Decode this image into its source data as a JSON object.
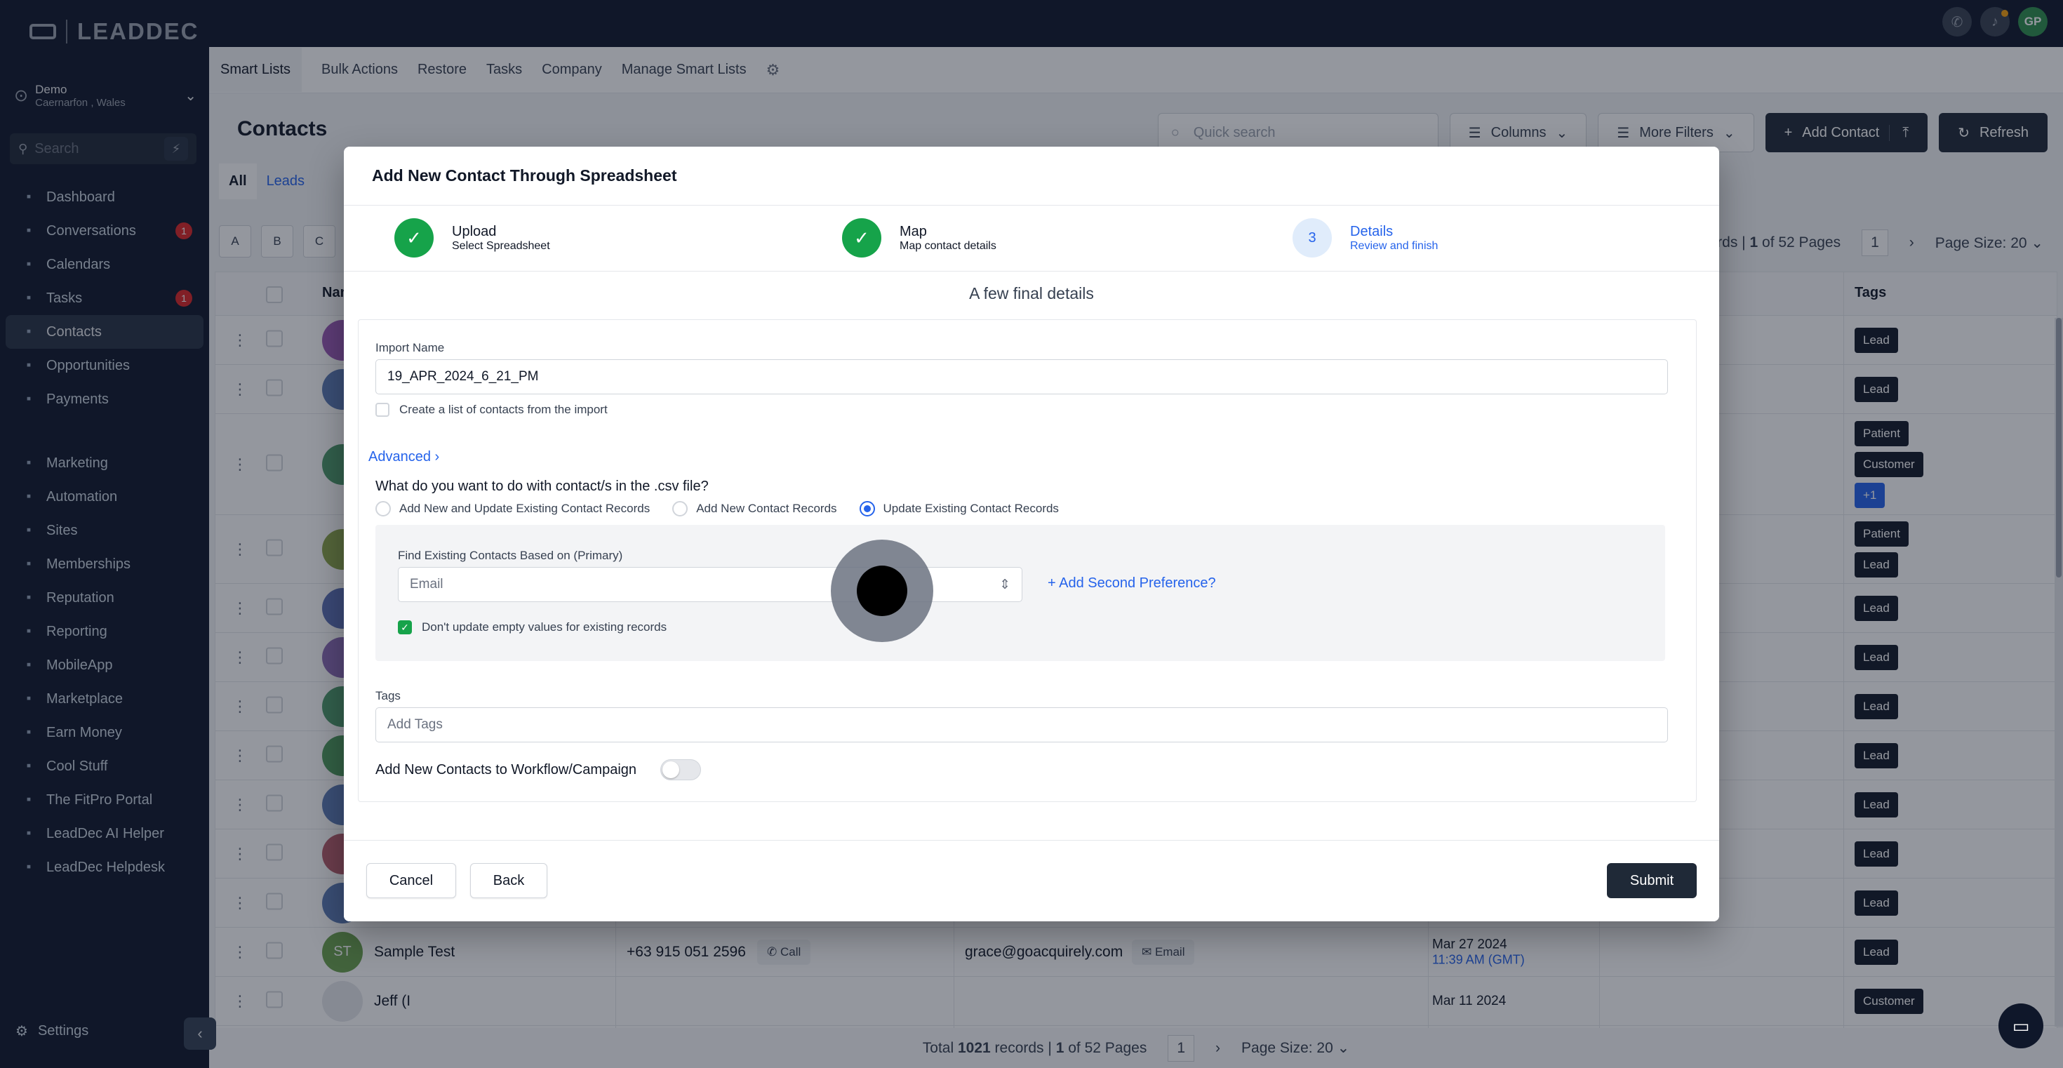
{
  "sidebar": {
    "brand": "LEADDEC",
    "location": {
      "name": "Demo",
      "address": "Caernarfon , Wales"
    },
    "search_placeholder": "Search",
    "items": [
      {
        "label": "Dashboard",
        "icon": "dashboard-icon",
        "badge": ""
      },
      {
        "label": "Conversations",
        "icon": "chat-icon",
        "badge": "1"
      },
      {
        "label": "Calendars",
        "icon": "calendar-icon",
        "badge": ""
      },
      {
        "label": "Tasks",
        "icon": "check-icon",
        "badge": "1"
      },
      {
        "label": "Contacts",
        "icon": "user-icon",
        "badge": ""
      },
      {
        "label": "Opportunities",
        "icon": "funnel-icon",
        "badge": ""
      },
      {
        "label": "Payments",
        "icon": "card-icon",
        "badge": ""
      }
    ],
    "items2": [
      {
        "label": "Marketing",
        "icon": "megaphone-icon"
      },
      {
        "label": "Automation",
        "icon": "automation-icon"
      },
      {
        "label": "Sites",
        "icon": "globe-icon"
      },
      {
        "label": "Memberships",
        "icon": "members-icon"
      },
      {
        "label": "Reputation",
        "icon": "star-icon"
      },
      {
        "label": "Reporting",
        "icon": "chart-icon"
      },
      {
        "label": "MobileApp",
        "icon": "phone-icon"
      },
      {
        "label": "Marketplace",
        "icon": "cart-icon"
      },
      {
        "label": "Earn Money",
        "icon": "money-icon"
      },
      {
        "label": "Cool Stuff",
        "icon": "fire-icon"
      },
      {
        "label": "The FitPro Portal",
        "icon": "dumbbell-icon"
      },
      {
        "label": "LeadDec AI Helper",
        "icon": "robot-icon"
      },
      {
        "label": "LeadDec Helpdesk",
        "icon": "info-icon"
      }
    ],
    "settings": "Settings",
    "user_initials": "GP"
  },
  "subnav": {
    "items": [
      "Smart Lists",
      "Bulk Actions",
      "Restore",
      "Tasks",
      "Company",
      "Manage Smart Lists"
    ]
  },
  "contacts": {
    "title": "Contacts",
    "quick_search_placeholder": "Quick search",
    "columns_btn": "Columns",
    "more_filters_btn": "More Filters",
    "add_contact_btn": "Add Contact",
    "refresh_btn": "Refresh",
    "tabs": [
      "All",
      "Leads"
    ],
    "letters": [
      "A",
      "B",
      "C"
    ],
    "pager_top": {
      "records_text": "ecords |",
      "page": "1",
      "of_pages": "of 52 Pages",
      "page_box": "1",
      "page_size": "Page Size: 20"
    },
    "headers": {
      "name": "Nam",
      "tags": "Tags"
    },
    "rows": [
      {
        "initials": "",
        "color": "#9b59b6",
        "name": "",
        "phone": "",
        "email": "",
        "date": "",
        "time": "",
        "tags": [
          "Lead"
        ]
      },
      {
        "initials": "",
        "color": "#5b7bb5",
        "name": "",
        "phone": "",
        "email": "",
        "date": "",
        "time": "",
        "tags": [
          "Lead"
        ]
      },
      {
        "initials": "",
        "color": "#4e9a6b",
        "name": "",
        "phone": "",
        "email": "",
        "date": "",
        "time": "",
        "tags": [
          "Patient",
          "Customer",
          "+1"
        ]
      },
      {
        "initials": "",
        "color": "#8ba44a",
        "name": "",
        "phone": "",
        "email": "",
        "date": "",
        "time": "",
        "tags": [
          "Patient",
          "Lead"
        ]
      },
      {
        "initials": "",
        "color": "#5b6fb5",
        "name": "",
        "phone": "",
        "email": "",
        "date": "",
        "time": "",
        "tags": [
          "Lead"
        ]
      },
      {
        "initials": "",
        "color": "#8a6bb5",
        "name": "",
        "phone": "",
        "email": "",
        "date": "",
        "time": "",
        "tags": [
          "Lead"
        ]
      },
      {
        "initials": "",
        "color": "#4e9a6b",
        "name": "",
        "phone": "",
        "email": "",
        "date": "",
        "time": "",
        "tags": [
          "Lead"
        ]
      },
      {
        "initials": "",
        "color": "#4e9a5b",
        "name": "",
        "phone": "",
        "email": "",
        "date": "",
        "time": "",
        "tags": [
          "Lead"
        ]
      },
      {
        "initials": "",
        "color": "#5b7bb5",
        "name": "",
        "phone": "",
        "email": "",
        "date": "",
        "time": "",
        "tags": [
          "Lead"
        ]
      },
      {
        "initials": "",
        "color": "#b55b6b",
        "name": "",
        "phone": "",
        "email": "",
        "date": "",
        "time": "",
        "tags": [
          "Lead"
        ]
      },
      {
        "initials": "",
        "color": "#5b7bb5",
        "name": "",
        "phone": "",
        "email": "",
        "date": "",
        "time": "",
        "tags": [
          "Lead"
        ]
      },
      {
        "initials": "ST",
        "color": "#6ba04e",
        "name": "Sample Test",
        "phone": "+63 915 051 2596",
        "email": "grace@goacquirely.com",
        "date": "Mar 27 2024",
        "time": "11:39 AM (GMT)",
        "tags": [
          "Lead"
        ]
      },
      {
        "initials": "",
        "color": "#e5e7eb",
        "name": "Jeff (I",
        "phone": "",
        "email": "",
        "date": "Mar 11 2024",
        "time": "",
        "tags": [
          "Customer"
        ]
      }
    ],
    "call_label": "Call",
    "email_label": "Email",
    "pager_bottom": {
      "total_prefix": "Total",
      "total": "1021",
      "records_word": "records |",
      "page": "1",
      "of_pages": "of 52 Pages",
      "page_box": "1",
      "page_size": "Page Size: 20"
    }
  },
  "modal": {
    "title": "Add New Contact Through Spreadsheet",
    "steps": [
      {
        "title": "Upload",
        "subtitle": "Select Spreadsheet",
        "state": "done",
        "num": ""
      },
      {
        "title": "Map",
        "subtitle": "Map contact details",
        "state": "done",
        "num": ""
      },
      {
        "title": "Details",
        "subtitle": "Review and finish",
        "state": "current",
        "num": "3"
      }
    ],
    "subtitle": "A few final details",
    "import_name_label": "Import Name",
    "import_name_value": "19_APR_2024_6_21_PM",
    "create_list_label": "Create a list of contacts from the import",
    "advanced_label": "Advanced",
    "question": "What do you want to do with contact/s in the .csv file?",
    "options": [
      {
        "label": "Add New and Update Existing Contact Records",
        "selected": false
      },
      {
        "label": "Add New Contact Records",
        "selected": false
      },
      {
        "label": "Update Existing Contact Records",
        "selected": true
      }
    ],
    "find_label": "Find Existing Contacts Based on (Primary)",
    "find_value": "Email",
    "add_second_pref": "Add Second Preference?",
    "dont_update_label": "Don't update empty values for existing records",
    "tags_label": "Tags",
    "tags_placeholder": "Add Tags",
    "workflow_label": "Add New Contacts to Workflow/Campaign",
    "cancel_btn": "Cancel",
    "back_btn": "Back",
    "submit_btn": "Submit"
  },
  "colors": {
    "sidebar_bg": "#0f172a",
    "accent_blue": "#2563eb",
    "success_green": "#16a34a",
    "dark_button": "#1f2937"
  }
}
